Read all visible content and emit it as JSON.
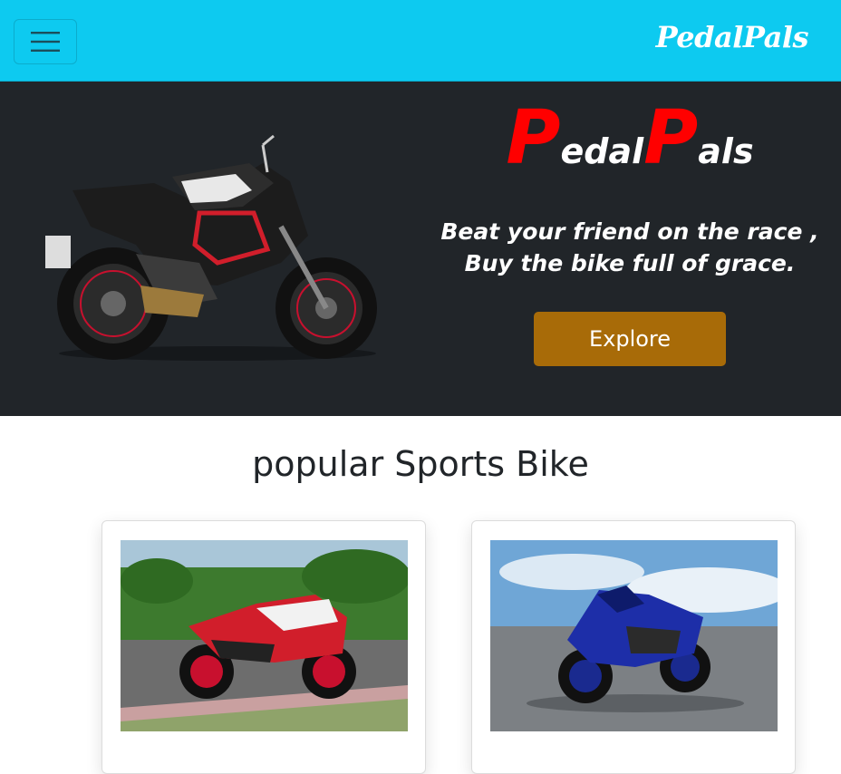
{
  "navbar": {
    "brand": "PedalPals",
    "toggler_icon": "menu-icon"
  },
  "hero": {
    "title_p1": "P",
    "title_rest1": "edal",
    "title_p2": "P",
    "title_rest2": "als",
    "tagline_line1": "Beat your friend on the race ,",
    "tagline_line2": "Buy the bike full of grace.",
    "explore_label": "Explore"
  },
  "section": {
    "title": "popular Sports Bike"
  },
  "colors": {
    "navbar": "#0dcaf0",
    "hero_bg": "#212529",
    "accent_red": "#ff0000",
    "explore_btn": "#a86b08"
  }
}
